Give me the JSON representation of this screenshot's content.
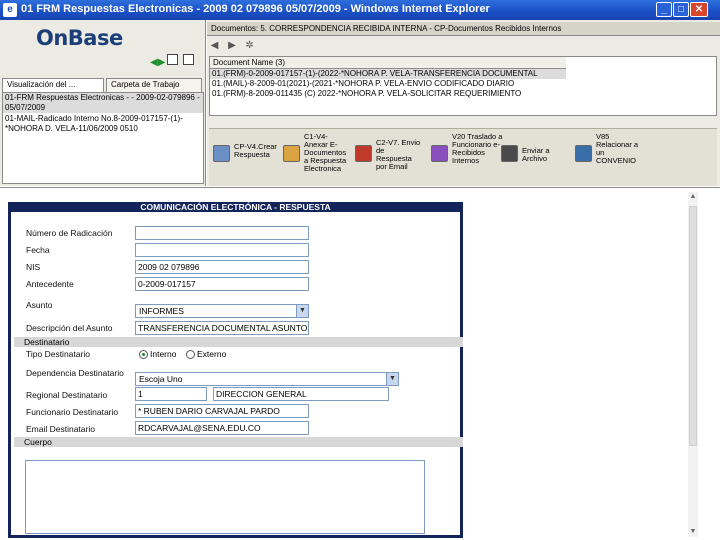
{
  "window": {
    "title": "01 FRM Respuestas Electronicas  -  2009 02 079896  05/07/2009  - Windows Internet Explorer",
    "min": "_",
    "max": "□",
    "close": "✕"
  },
  "left": {
    "logo": "OnBase",
    "tabs": [
      "Visualización del ...",
      "Carpeta de Trabajo"
    ],
    "items": [
      "01-FRM Respuestas Electronicas - - 2009-02-079896 - 05/07/2009",
      "01-MAIL-Radicado Interno No.8-2009-017157-(1)-*NOHORA D. VELA-11/06/2009 0510"
    ]
  },
  "right": {
    "tab": "Documentos: 5. CORRESPONDENCIA RECIBIDA INTERNA - CP-Documentos Recibidos Internos",
    "list_header": "Document Name (3)",
    "rows": [
      "01.(FRM)-0-2009-017157-(1)-(2022-*NOHORA P. VELA-TRANSFERENCIA DOCUMENTAL",
      "01.(MAIL)-8-2009-01(2021)-(2021-*NOHORA P. VELA-ENVIO CODIFICADO DIARIO",
      "01.(FRM)-8-2009-011435 (C) 2022-*NOHORA P. VELA-SOLICITAR REQUERIMIENTO"
    ],
    "tasks": [
      {
        "label": "CP-V4.Crear Respuesta",
        "icon": "create-response-icon",
        "color": "#6a8fc4"
      },
      {
        "label": "C1-V4-Anexar E-Documentos a Respuesta Electronica",
        "icon": "attach-documents-icon",
        "color": "#d9a441"
      },
      {
        "label": "C2-V7. Envio de Respuesta por Email",
        "icon": "send-email-icon",
        "color": "#c03a2b"
      },
      {
        "label": "V20 Traslado a Funcionario e-Recibidos Internos",
        "icon": "transfer-icon",
        "color": "#8a4fbf"
      },
      {
        "label": "Enviar a Archivo",
        "icon": "archive-icon",
        "color": "#4a4a4a"
      },
      {
        "label": "V85 Relacionar a un CONVENIO",
        "icon": "relate-agreement-icon",
        "color": "#3a6ea8"
      }
    ]
  },
  "form": {
    "title": "COMUNICACIÓN ELECTRÓNICA - RESPUESTA",
    "labels": {
      "radicado": "Número de Radicación",
      "fecha": "Fecha",
      "nis": "NIS",
      "antecedente": "Antecedente",
      "asunto": "Asunto",
      "descripcion": "Descripción del Asunto",
      "tipo": "Tipo Destinatario",
      "dependencia": "Dependencia Destinatario",
      "regional": "Regional Destinatario",
      "funcionario": "Funcionario Destinatario",
      "email": "Email Destinatario"
    },
    "sections": {
      "destinatario": "Destinatario",
      "cuerpo": "Cuerpo"
    },
    "values": {
      "radicado": "",
      "fecha": "",
      "nis": "2009 02 079896",
      "antecedente": "0-2009-017157",
      "asunto": "INFORMES",
      "descripcion": "TRANSFERENCIA DOCUMENTAL ASUNTO",
      "dependencia": "Escoja Uno",
      "regional_code": "1",
      "regional_name": "DIRECCION GENERAL",
      "funcionario": "* RUBEN DARIO CARVAJAL PARDO",
      "email": "RDCARVAJAL@SENA.EDU.CO"
    },
    "radio": {
      "interno": "Interno",
      "externo": "Externo",
      "selected": "Interno"
    }
  }
}
